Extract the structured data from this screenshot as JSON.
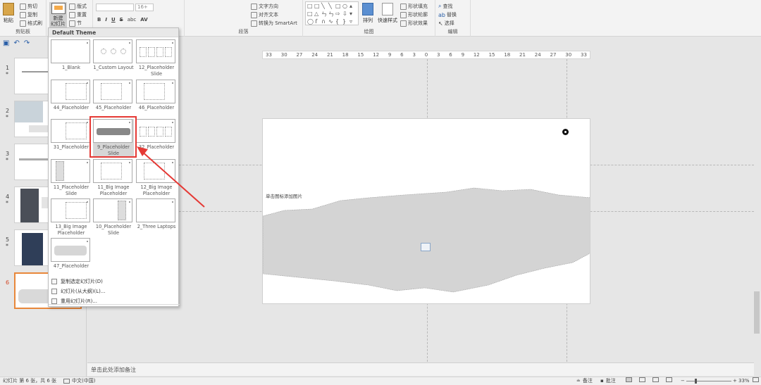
{
  "ribbon": {
    "clipboard": {
      "paste": "粘贴",
      "cut": "剪切",
      "copy": "复制",
      "format_painter": "格式刷",
      "group": "剪贴板"
    },
    "slides": {
      "new_slide": "新建\n幻灯片",
      "layout": "版式",
      "reset": "重置",
      "section": "节"
    },
    "font": {
      "size": "16+",
      "bold": "B",
      "italic": "I",
      "underline": "U",
      "strike": "S",
      "spacing": "abc",
      "case": "AV"
    },
    "paragraph": {
      "text_direction": "文字方向",
      "align_text": "对齐文本",
      "convert_smartart": "转换为 SmartArt",
      "group": "段落"
    },
    "drawing": {
      "arrange": "排列",
      "quick_styles": "快速样式",
      "shape_fill": "形状填充",
      "shape_outline": "形状轮廓",
      "shape_effects": "形状效果",
      "group": "绘图"
    },
    "editing": {
      "find": "查找",
      "replace": "替换",
      "select": "选择",
      "group": "编辑"
    }
  },
  "gallery": {
    "title": "Default Theme",
    "layouts": [
      {
        "name": "1_Blank"
      },
      {
        "name": "1_Custom Layout"
      },
      {
        "name": "12_Placeholder Slide"
      },
      {
        "name": "44_Placeholder"
      },
      {
        "name": "45_Placeholder"
      },
      {
        "name": "46_Placeholder"
      },
      {
        "name": "31_Placeholder"
      },
      {
        "name": "9_Placeholder Slide",
        "selected": true
      },
      {
        "name": "32_Placeholder"
      },
      {
        "name": "11_Placeholder Slide"
      },
      {
        "name": "11_Big Image Placeholder"
      },
      {
        "name": "12_Big Image Placeholder"
      },
      {
        "name": "13_Big Image Placeholder"
      },
      {
        "name": "10_Placeholder Slide"
      },
      {
        "name": "2_Three Laptops"
      },
      {
        "name": "47_Placeholder"
      }
    ],
    "menu": [
      {
        "label": "复制选定幻灯片(D)"
      },
      {
        "label": "幻灯片(从大纲)(L)..."
      },
      {
        "label": "重用幻灯片(R)..."
      }
    ]
  },
  "thumbnails": [
    {
      "num": "1",
      "star": "*"
    },
    {
      "num": "2",
      "star": "*"
    },
    {
      "num": "3",
      "star": "*"
    },
    {
      "num": "4",
      "star": "*"
    },
    {
      "num": "5",
      "star": "*"
    },
    {
      "num": "6",
      "star": "",
      "active": true
    }
  ],
  "ruler": {
    "ticks": [
      "33",
      "30",
      "27",
      "24",
      "21",
      "18",
      "15",
      "12",
      "9",
      "6",
      "3",
      "0",
      "3",
      "6",
      "9",
      "12",
      "15",
      "18",
      "21",
      "24",
      "27",
      "30",
      "33"
    ]
  },
  "slide": {
    "placeholder_text": "单击图标添加图片"
  },
  "notes": {
    "placeholder": "单击此处添加备注"
  },
  "status": {
    "slide_info": "幻灯片 第 6 张，共 6 张",
    "language": "中文(中国)",
    "notes": "备注",
    "comments": "批注",
    "zoom": "33%"
  },
  "colors": {
    "highlight": "#e53935",
    "active_thumb": "#e8873a",
    "accent": "#d24726"
  }
}
